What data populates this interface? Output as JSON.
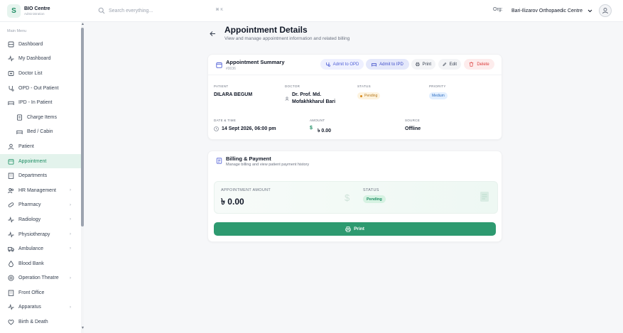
{
  "brand": {
    "logo_letter": "S",
    "name": "BIO Centre",
    "sub": "Administration"
  },
  "search": {
    "placeholder": "Search everything...",
    "shortcut": "⌘ K"
  },
  "org": {
    "label": "Org:",
    "selected": "Bari-Ilizarov Orthopaedic Centre"
  },
  "sidebar": {
    "menu_title": "Main Menu",
    "items": [
      {
        "label": "Dashboard",
        "icon": "dashboard-icon"
      },
      {
        "label": "My Dashboard",
        "icon": "activity-icon"
      },
      {
        "label": "Doctor List",
        "icon": "doctor-icon"
      },
      {
        "label": "OPD - Out Patient",
        "icon": "stethoscope-icon"
      },
      {
        "label": "IPD - In Patient",
        "icon": "bed-icon",
        "expanded": true
      },
      {
        "label": "Charge Items",
        "icon": "receipt-icon",
        "sub": true
      },
      {
        "label": "Bed / Cabin",
        "icon": "bed-icon",
        "sub": true
      },
      {
        "label": "Patient",
        "icon": "user-icon"
      },
      {
        "label": "Appointment",
        "icon": "calendar-icon",
        "active": true
      },
      {
        "label": "Departments",
        "icon": "building-icon"
      },
      {
        "label": "HR Management",
        "icon": "users-icon",
        "arrow": "›"
      },
      {
        "label": "Pharmacy",
        "icon": "pill-icon",
        "arrow": "›"
      },
      {
        "label": "Radiology",
        "icon": "activity-icon",
        "arrow": "›"
      },
      {
        "label": "Physiotherapy",
        "icon": "activity-icon",
        "arrow": "›"
      },
      {
        "label": "Ambulance",
        "icon": "truck-icon",
        "arrow": "›"
      },
      {
        "label": "Blood Bank",
        "icon": "drop-icon"
      },
      {
        "label": "Operation Theatre",
        "icon": "target-icon",
        "arrow": "›"
      },
      {
        "label": "Front Office",
        "icon": "building-icon"
      },
      {
        "label": "Apparatus",
        "icon": "activity-icon",
        "arrow": "›"
      },
      {
        "label": "Birth & Death",
        "icon": "heart-icon"
      }
    ]
  },
  "page": {
    "title": "Appointment Details",
    "subtitle": "View and manage appointment information and related billing"
  },
  "summary": {
    "title": "Appointment Summary",
    "id": "#0036",
    "buttons": {
      "admit_opd": "Admit to OPD",
      "admit_ipd": "Admit to IPD",
      "print": "Print",
      "edit": "Edit",
      "delete": "Delete"
    },
    "fields": {
      "patient_label": "PATIENT",
      "patient_value": "DILARA BEGUM",
      "doctor_label": "DOCTOR",
      "doctor_line1": "Dr. Prof. Md.",
      "doctor_line2": "Mofakhkharul Bari",
      "status_label": "STATUS",
      "status_value": "Pending",
      "priority_label": "PRIORITY",
      "priority_value": "Medium",
      "datetime_label": "DATE & TIME",
      "datetime_value": "14 Sept 2026, 06:00 pm",
      "amount_label": "AMOUNT",
      "amount_value": "৳ 0.00",
      "source_label": "SOURCE",
      "source_value": "Offline"
    }
  },
  "billing": {
    "title": "Billing & Payment",
    "subtitle": "Manage billing and view patient payment history",
    "amount_label": "APPOINTMENT AMOUNT",
    "amount_value": "৳ 0.00",
    "status_label": "STATUS",
    "status_value": "Pending",
    "print_label": "Print"
  },
  "colors": {
    "accent": "#2e9a70",
    "active_bg": "#e3f3ec",
    "danger": "#dc3b3b",
    "indigo": "#4f5fd6"
  }
}
